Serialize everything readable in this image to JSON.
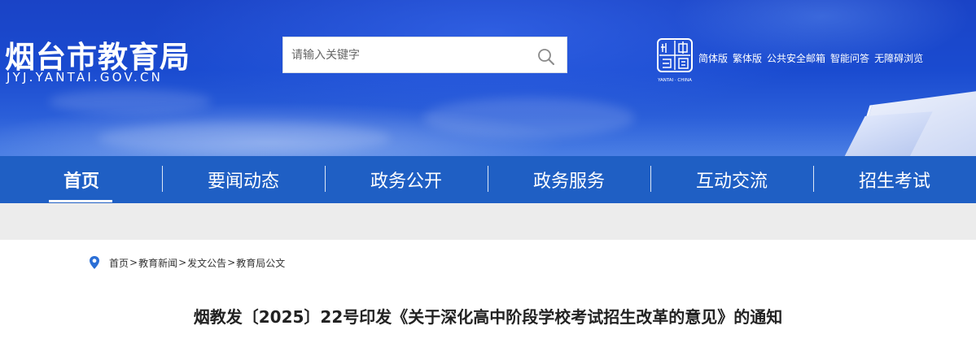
{
  "header": {
    "site_title": "烟台市教育局",
    "site_domain": "JYJ.YANTAI.GOV.CN",
    "search_placeholder": "请输入关键字",
    "seal_caption": "YANTAI · CHINA",
    "links": [
      "简体版",
      "繁体版",
      "公共安全邮箱",
      "智能问答",
      "无障碍浏览"
    ]
  },
  "nav": {
    "items": [
      "首页",
      "要闻动态",
      "政务公开",
      "政务服务",
      "互动交流",
      "招生考试"
    ],
    "active_index": 0
  },
  "breadcrumb": [
    "首页",
    "教育新闻",
    "发文公告",
    "教育局公文"
  ],
  "breadcrumb_separator": ">",
  "article": {
    "title": "烟教发〔2025〕22号印发《关于深化高中阶段学校考试招生改革的意见》的通知"
  },
  "colors": {
    "header_blue": "#1a43c6",
    "nav_blue": "#1f5fc4",
    "band_grey": "#ececec",
    "pin_blue": "#2b6fd6"
  },
  "icons": {
    "search": "search-icon",
    "location": "location-pin-icon",
    "seal": "yantai-seal-icon"
  }
}
